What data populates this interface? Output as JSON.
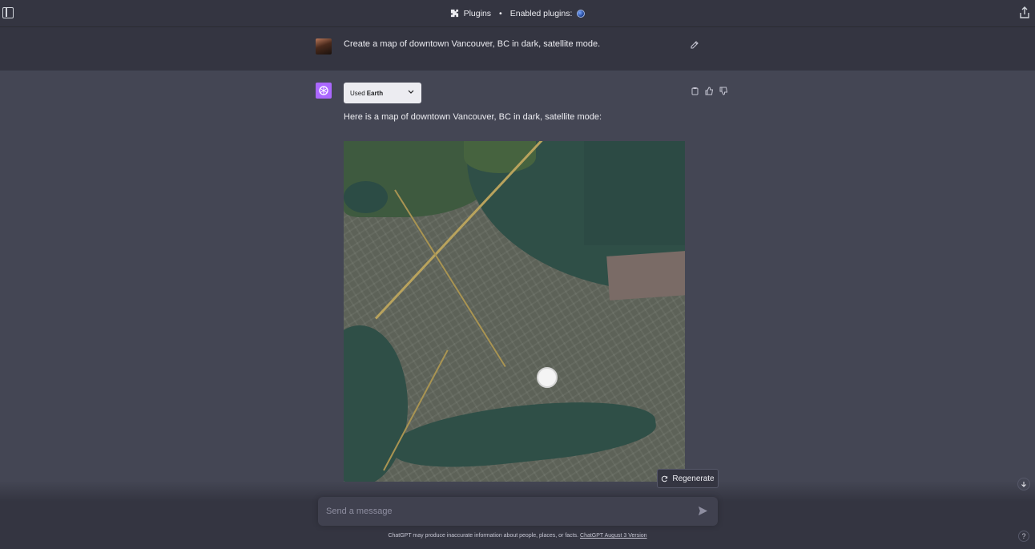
{
  "header": {
    "plugins_label": "Plugins",
    "separator": "•",
    "enabled_label": "Enabled plugins:",
    "enabled_plugin_icon": "earth-globe-icon"
  },
  "user_message": {
    "text": "Create a map of downtown Vancouver, BC in dark, satellite mode."
  },
  "assistant_message": {
    "plugin_used_prefix": "Used",
    "plugin_used_name": "Earth",
    "text": "Here is a map of downtown Vancouver, BC in dark, satellite mode:"
  },
  "actions": {
    "regenerate_label": "Regenerate"
  },
  "composer": {
    "placeholder": "Send a message"
  },
  "footer": {
    "disclaimer": "ChatGPT may produce inaccurate information about people, places, or facts.",
    "version_link": "ChatGPT August 3 Version",
    "help": "?"
  },
  "colors": {
    "background": "#343541",
    "assistant_background": "#444654",
    "bot_avatar": "#ab68ff"
  }
}
